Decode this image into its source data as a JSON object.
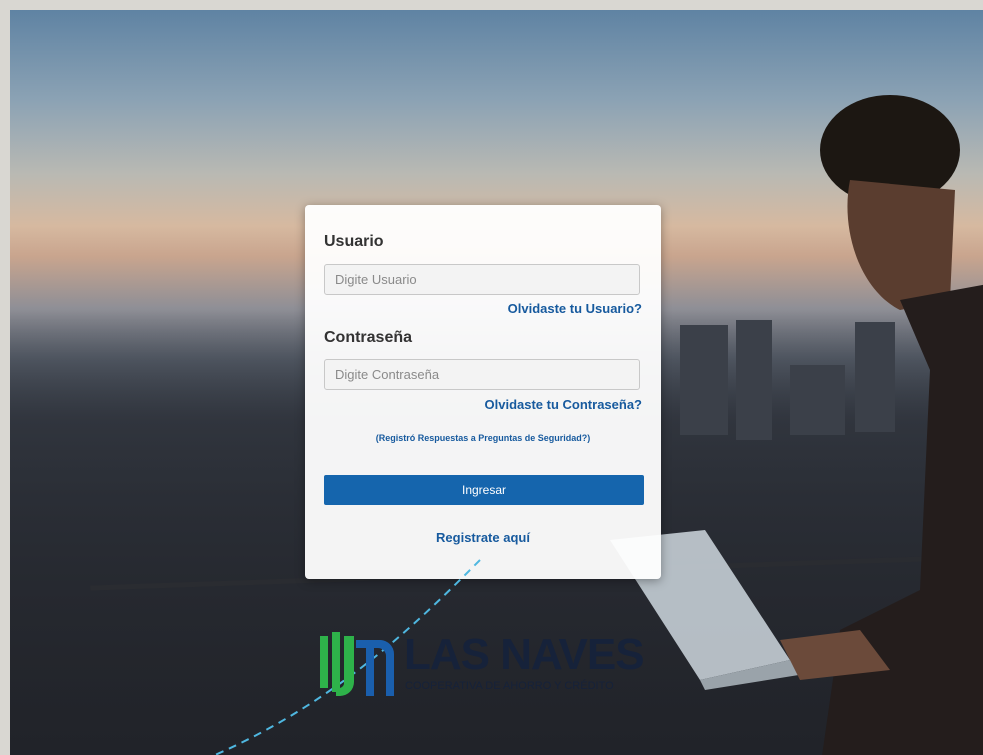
{
  "login": {
    "user_label": "Usuario",
    "user_placeholder": "Digite Usuario",
    "forgot_user": "Olvidaste tu Usuario?",
    "password_label": "Contraseña",
    "password_placeholder": "Digite Contraseña",
    "forgot_password": "Olvidaste tu Contraseña?",
    "security_questions": "(Registró Respuestas a Preguntas de Seguridad?)",
    "submit_label": "Ingresar",
    "register_link": "Registrate aquí"
  },
  "brand": {
    "name": "LAS NAVES",
    "tagline": "COOPERATIVA DE AHORRO Y CRÉDITO",
    "colors": {
      "green": "#2eb24a",
      "blue": "#1a5fad",
      "navy": "#16223a"
    }
  },
  "colors": {
    "accent_button": "#1565ad",
    "link": "#175a9e"
  }
}
